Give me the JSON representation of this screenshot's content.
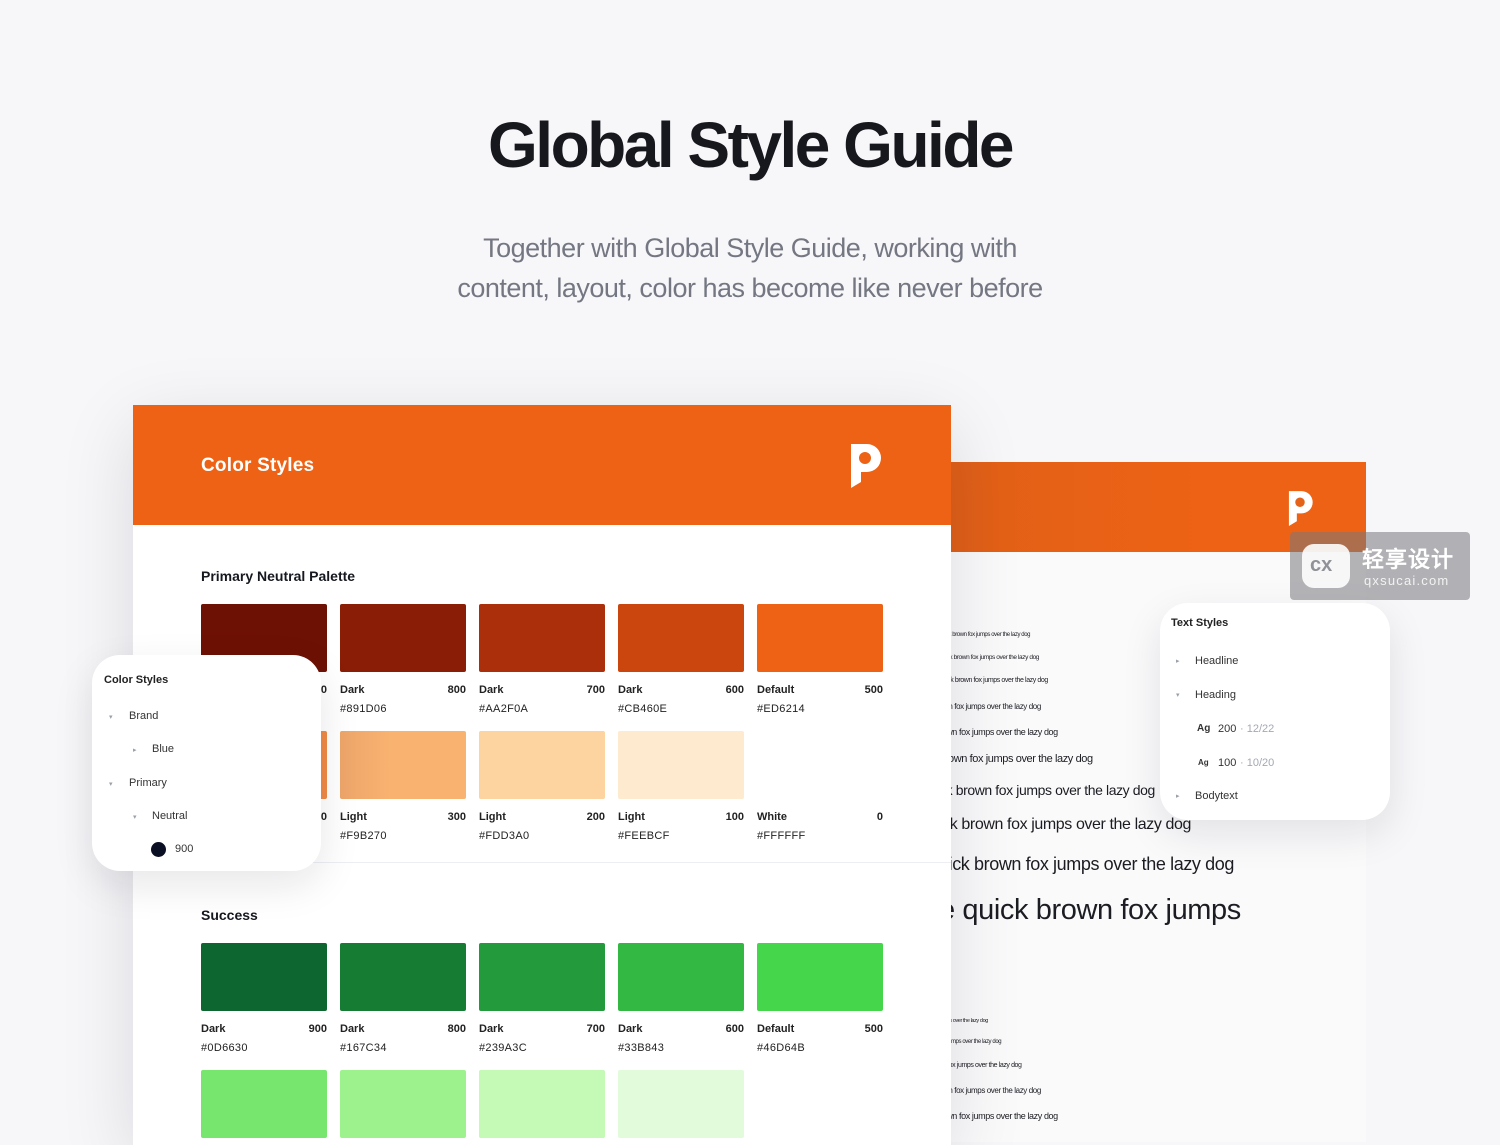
{
  "hero": {
    "title": "Global Style Guide",
    "subtitle_line1": "Together with Global Style Guide, working with",
    "subtitle_line2": "content, layout, color has become like never before"
  },
  "color_card": {
    "header_title": "Color Styles",
    "logo_icon": "p-logo-icon",
    "accent": "#ED6214",
    "sections": [
      {
        "title": "Primary Neutral Palette",
        "rows": [
          [
            {
              "name": "",
              "num": "0",
              "hex": "",
              "color": "#6E1105"
            },
            {
              "name": "Dark",
              "num": "800",
              "hex": "#891D06",
              "color": "#891D06"
            },
            {
              "name": "Dark",
              "num": "700",
              "hex": "#AA2F0A",
              "color": "#AA2F0A"
            },
            {
              "name": "Dark",
              "num": "600",
              "hex": "#CB460E",
              "color": "#CB460E"
            },
            {
              "name": "Default",
              "num": "500",
              "hex": "#ED6214",
              "color": "#ED6214"
            }
          ],
          [
            {
              "name": "",
              "num": "0",
              "hex": "",
              "color": "#F08A45"
            },
            {
              "name": "Light",
              "num": "300",
              "hex": "#F9B270",
              "color": "#F9B270"
            },
            {
              "name": "Light",
              "num": "200",
              "hex": "#FDD3A0",
              "color": "#FDD3A0"
            },
            {
              "name": "Light",
              "num": "100",
              "hex": "#FEEBCF",
              "color": "#FEEBCF"
            },
            {
              "name": "White",
              "num": "0",
              "hex": "#FFFFFF",
              "color": "#FFFFFF"
            }
          ]
        ]
      },
      {
        "title": "Success",
        "rows": [
          [
            {
              "name": "Dark",
              "num": "900",
              "hex": "#0D6630",
              "color": "#0D6630"
            },
            {
              "name": "Dark",
              "num": "800",
              "hex": "#167C34",
              "color": "#167C34"
            },
            {
              "name": "Dark",
              "num": "700",
              "hex": "#239A3C",
              "color": "#239A3C"
            },
            {
              "name": "Dark",
              "num": "600",
              "hex": "#33B843",
              "color": "#33B843"
            },
            {
              "name": "Default",
              "num": "500",
              "hex": "#46D64B",
              "color": "#46D64B"
            }
          ],
          [
            {
              "name": "",
              "num": "",
              "hex": "",
              "color": "#76E66E"
            },
            {
              "name": "",
              "num": "",
              "hex": "",
              "color": "#9DF28E"
            },
            {
              "name": "",
              "num": "",
              "hex": "",
              "color": "#C4F9B6"
            },
            {
              "name": "",
              "num": "",
              "hex": "",
              "color": "#E2FCDB"
            }
          ]
        ]
      }
    ]
  },
  "color_panel": {
    "title": "Color Styles",
    "items": [
      {
        "label": "Brand",
        "caret": "▾"
      },
      {
        "label": "Blue",
        "caret": "▸"
      },
      {
        "label": "Primary",
        "caret": "▾"
      },
      {
        "label": "Neutral",
        "caret": "▾"
      },
      {
        "label": "900",
        "caret": ""
      }
    ],
    "swatch_color": "#0B0F24"
  },
  "text_card": {
    "samples_top": [
      "quick brown fox jumps over the lazy dog",
      "quick brown fox jumps over the lazy dog",
      "quick brown fox jumps over the lazy dog",
      "own fox jumps over the lazy dog",
      "rown fox jumps over the lazy dog",
      "brown fox jumps over the lazy dog",
      "ck brown fox jumps over the lazy dog",
      "ick brown fox jumps over the lazy dog",
      "uick brown fox jumps over the lazy dog",
      "e quick brown fox jumps"
    ],
    "samples_bottom": [
      "jumps over the lazy dog",
      "fox jumps over the lazy dog",
      "vn fox jumps over the lazy dog",
      "own fox jumps over the lazy dog",
      "rown fox jumps over the lazy dog"
    ]
  },
  "text_panel": {
    "title": "Text Styles",
    "items": [
      {
        "label": "Headline",
        "caret": "▸"
      },
      {
        "label": "Heading",
        "caret": "▾"
      },
      {
        "ag": "Ag",
        "value": "200",
        "meta": "· 12/22"
      },
      {
        "ag": "Ag",
        "value": "100",
        "meta": "· 10/20"
      },
      {
        "label": "Bodytext",
        "caret": "▸"
      }
    ]
  },
  "watermark": {
    "cn": "轻享设计",
    "en": "qxsucai.com",
    "icon": "qx-logo-icon",
    "icon_glyph": "cx"
  }
}
